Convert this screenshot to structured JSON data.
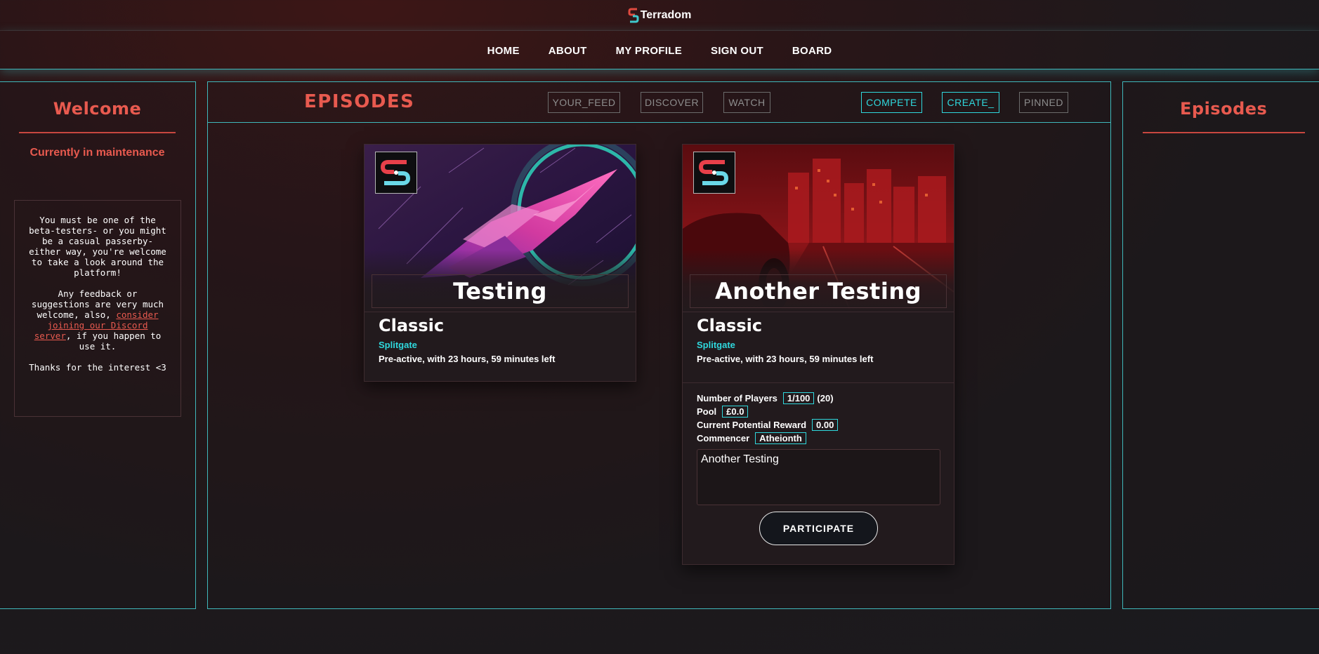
{
  "brand": {
    "name": "Terradom"
  },
  "nav": {
    "items": [
      {
        "label": "HOME"
      },
      {
        "label": "ABOUT"
      },
      {
        "label": "MY PROFILE"
      },
      {
        "label": "SIGN OUT"
      },
      {
        "label": "BOARD"
      }
    ]
  },
  "left_panel": {
    "title": "Welcome",
    "maintenance": "Currently in maintenance",
    "paragraph1": "You must be one of the beta-testers- or you might be a casual passerby- either way, you're welcome to take a look around the platform!",
    "paragraph2_before": "Any feedback or suggestions are very much welcome, also, ",
    "paragraph2_link": "consider joining our Discord server",
    "paragraph2_after": ", if you happen to use it.",
    "paragraph3": "Thanks for the interest <3"
  },
  "main": {
    "title": "EPISODES",
    "tabs": [
      {
        "label": "YOUR_FEED",
        "active": false
      },
      {
        "label": "DISCOVER",
        "active": false
      },
      {
        "label": "WATCH",
        "active": false
      },
      {
        "label": "COMPETE",
        "active": true
      },
      {
        "label": "CREATE_",
        "active": true
      },
      {
        "label": "PINNED",
        "active": false
      }
    ],
    "cards": [
      {
        "name": "Testing",
        "mode": "Classic",
        "game": "Splitgate",
        "status": "Pre-active, with 23 hours, 59 minutes left"
      },
      {
        "name": "Another Testing",
        "mode": "Classic",
        "game": "Splitgate",
        "status": "Pre-active, with 23 hours, 59 minutes left",
        "players_label": "Number of Players",
        "players_value": "1/100",
        "players_extra": "(20)",
        "pool_label": "Pool",
        "pool_value": "£0.0",
        "reward_label": "Current Potential Reward",
        "reward_value": "0.00",
        "commencer_label": "Commencer",
        "commencer_value": "Atheionth",
        "description": "Another Testing",
        "participate_label": "PARTICIPATE"
      }
    ]
  },
  "right_panel": {
    "title": "Episodes"
  },
  "colors": {
    "accent_red": "#e85a4f",
    "accent_cyan": "#2fd8dd",
    "panel_border": "#3fb8bb"
  }
}
